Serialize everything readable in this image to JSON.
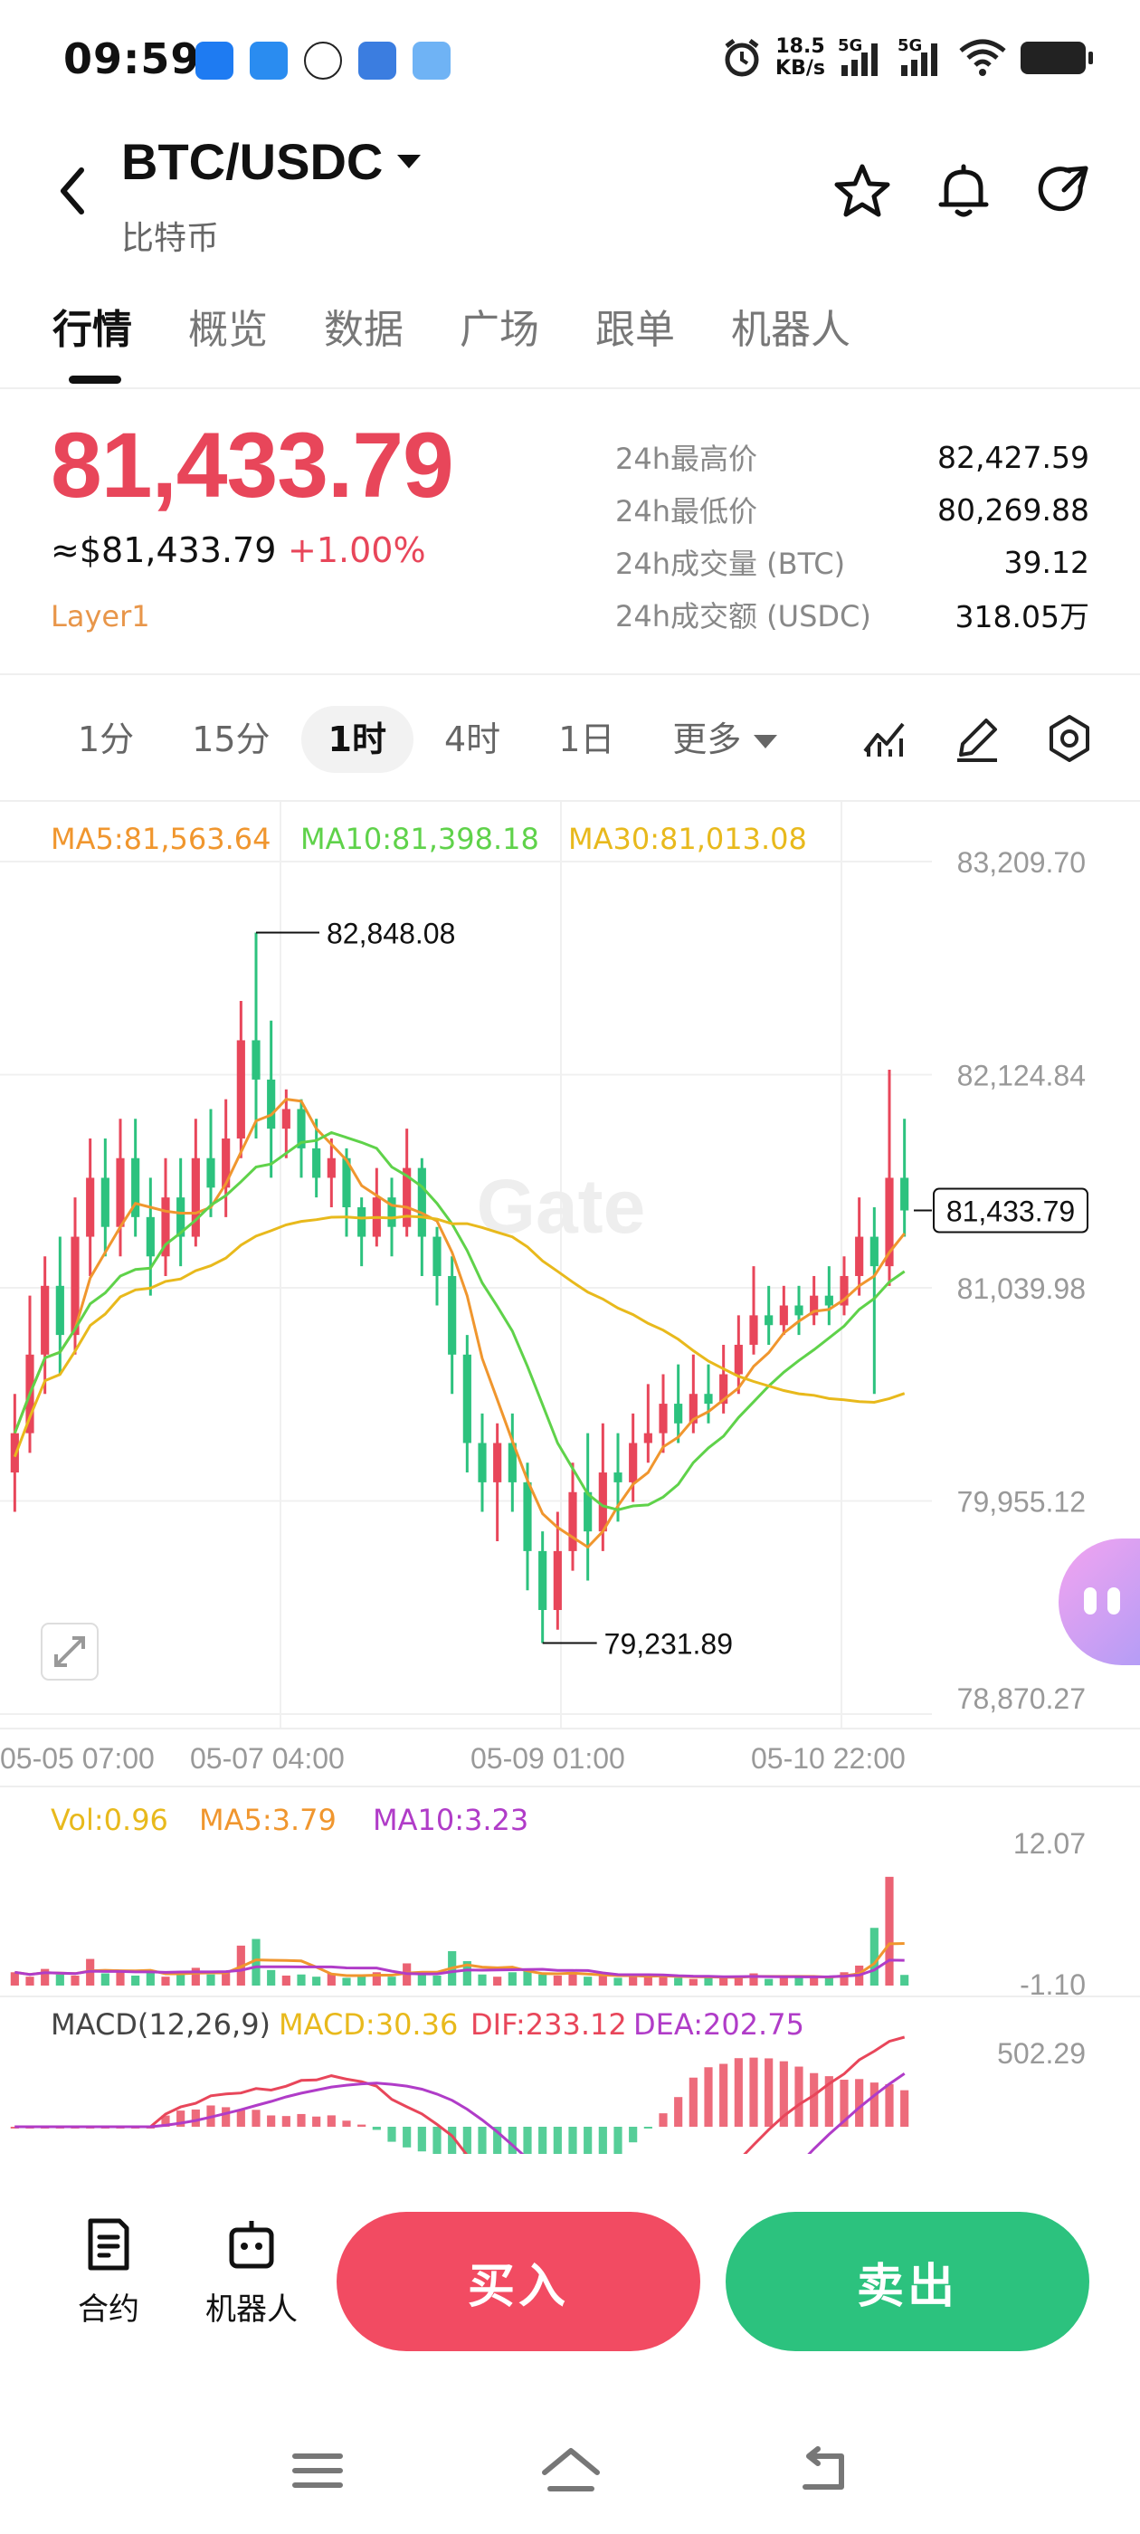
{
  "status_bar": {
    "time": "09:59",
    "net_speed_value": "18.5",
    "net_speed_unit": "KB/s",
    "signal1_label": "5G",
    "signal2_label": "5G"
  },
  "header": {
    "pair": "BTC/USDC",
    "subtitle": "比特币",
    "icons": [
      "back-arrow-icon",
      "star-icon",
      "bell-icon",
      "share-icon"
    ]
  },
  "tabs": [
    "行情",
    "概览",
    "数据",
    "广场",
    "跟单",
    "机器人"
  ],
  "price": {
    "last": "81,433.79",
    "usd": "≈$81,433.79",
    "change": "+1.00%",
    "tag": "Layer1"
  },
  "stats": [
    {
      "label": "24h最高价",
      "value": "82,427.59"
    },
    {
      "label": "24h最低价",
      "value": "80,269.88"
    },
    {
      "label": "24h成交量 (BTC)",
      "value": "39.12"
    },
    {
      "label": "24h成交额 (USDC)",
      "value": "318.05万"
    }
  ],
  "intervals": [
    "1分",
    "15分",
    "1时",
    "4时",
    "1日",
    "更多"
  ],
  "active_interval": "1时",
  "chart_legend": {
    "ma5": "MA5:81,563.64",
    "ma10": "MA10:81,398.18",
    "ma30": "MA30:81,013.08",
    "vol": "Vol:0.96",
    "vol_ma5": "MA5:3.79",
    "vol_ma10": "MA10:3.23",
    "macd_title": "MACD(12,26,9)",
    "macd": "MACD:30.36",
    "dif": "DIF:233.12",
    "dea": "DEA:202.75"
  },
  "colors": {
    "up": "#e8465a",
    "down": "#2cc27e",
    "ma5": "#f0962e",
    "ma10": "#5fd24a",
    "ma30": "#e8b91c",
    "vol_ma10": "#b03cc8",
    "dea": "#b03cc8",
    "watermark": "Gate"
  },
  "chart_data": {
    "type": "candlestick",
    "y_ticks": [
      "83,209.70",
      "82,124.84",
      "81,039.98",
      "79,955.12",
      "78,870.27"
    ],
    "ylim": [
      78870.27,
      83209.7
    ],
    "x_ticks": [
      "05-05 07:00",
      "05-07 04:00",
      "05-09 01:00",
      "05-10 22:00"
    ],
    "current_price_label": "81,433.79",
    "annotations": {
      "high": "82,848.08",
      "low": "79,231.89"
    },
    "volume_ticks": [
      "12.07",
      "-1.10"
    ],
    "macd_ticks": [
      "502.29"
    ],
    "candles": [
      [
        80100,
        80300,
        79900,
        80500
      ],
      [
        80300,
        80700,
        80200,
        81000
      ],
      [
        80700,
        81050,
        80500,
        81200
      ],
      [
        81050,
        80800,
        80600,
        81300
      ],
      [
        80800,
        81300,
        80700,
        81500
      ],
      [
        81300,
        81600,
        81100,
        81800
      ],
      [
        81600,
        81350,
        81200,
        81800
      ],
      [
        81350,
        81700,
        81200,
        81900
      ],
      [
        81700,
        81400,
        81300,
        81900
      ],
      [
        81400,
        81200,
        81000,
        81600
      ],
      [
        81200,
        81500,
        81100,
        81700
      ],
      [
        81500,
        81300,
        81150,
        81700
      ],
      [
        81300,
        81700,
        81250,
        81900
      ],
      [
        81700,
        81550,
        81400,
        81950
      ],
      [
        81550,
        81800,
        81400,
        82000
      ],
      [
        81800,
        82300,
        81700,
        82500
      ],
      [
        82300,
        82100,
        81800,
        82848.08
      ],
      [
        82100,
        81850,
        81600,
        82400
      ],
      [
        81850,
        81950,
        81700,
        82050
      ],
      [
        81950,
        81750,
        81600,
        82000
      ],
      [
        81750,
        81600,
        81500,
        81900
      ],
      [
        81600,
        81700,
        81450,
        81800
      ],
      [
        81700,
        81450,
        81300,
        81750
      ],
      [
        81450,
        81300,
        81150,
        81500
      ],
      [
        81300,
        81500,
        81250,
        81650
      ],
      [
        81500,
        81350,
        81200,
        81600
      ],
      [
        81350,
        81650,
        81300,
        81850
      ],
      [
        81650,
        81300,
        81100,
        81700
      ],
      [
        81300,
        81100,
        80950,
        81350
      ],
      [
        81100,
        80700,
        80500,
        81200
      ],
      [
        80700,
        80250,
        80100,
        80800
      ],
      [
        80250,
        80050,
        79900,
        80400
      ],
      [
        80050,
        80250,
        79750,
        80350
      ],
      [
        80250,
        80050,
        79900,
        80400
      ],
      [
        80050,
        79700,
        79500,
        80150
      ],
      [
        79700,
        79400,
        79231.89,
        79800
      ],
      [
        79400,
        79700,
        79300,
        79900
      ],
      [
        79700,
        80000,
        79600,
        80150
      ],
      [
        80000,
        79800,
        79550,
        80300
      ],
      [
        79800,
        80100,
        79700,
        80350
      ],
      [
        80100,
        80050,
        79850,
        80300
      ],
      [
        80050,
        80250,
        79950,
        80400
      ],
      [
        80250,
        80300,
        80150,
        80550
      ],
      [
        80300,
        80450,
        80200,
        80600
      ],
      [
        80450,
        80350,
        80250,
        80650
      ],
      [
        80350,
        80500,
        80300,
        80700
      ],
      [
        80500,
        80450,
        80350,
        80650
      ],
      [
        80450,
        80600,
        80400,
        80750
      ],
      [
        80600,
        80750,
        80500,
        80900
      ],
      [
        80750,
        80900,
        80700,
        81150
      ],
      [
        80900,
        80850,
        80750,
        81050
      ],
      [
        80850,
        80950,
        80800,
        81050
      ],
      [
        80950,
        80900,
        80800,
        81050
      ],
      [
        80900,
        81000,
        80850,
        81100
      ],
      [
        81000,
        80950,
        80850,
        81150
      ],
      [
        80950,
        81100,
        80900,
        81200
      ],
      [
        81100,
        81300,
        81000,
        81500
      ],
      [
        81300,
        81150,
        80500,
        81450
      ],
      [
        81150,
        81600,
        81050,
        82150
      ],
      [
        81600,
        81433.79,
        81300,
        81900
      ]
    ],
    "volumes": [
      1.2,
      0.8,
      1.5,
      1.0,
      0.9,
      2.4,
      1.1,
      1.3,
      0.9,
      1.2,
      0.8,
      1.1,
      1.6,
      1.0,
      1.2,
      3.6,
      4.2,
      1.4,
      0.9,
      1.0,
      0.8,
      1.1,
      0.7,
      0.9,
      1.2,
      0.8,
      2.0,
      1.1,
      0.9,
      3.1,
      2.2,
      1.0,
      0.8,
      1.2,
      1.4,
      1.0,
      0.9,
      1.1,
      0.8,
      1.0,
      0.7,
      0.9,
      0.8,
      1.0,
      0.7,
      0.6,
      0.8,
      0.7,
      0.9,
      1.1,
      0.6,
      0.8,
      0.7,
      0.9,
      0.8,
      1.2,
      1.8,
      5.2,
      9.8,
      0.96
    ]
  },
  "bottom": {
    "contract_label": "合约",
    "bot_label": "机器人",
    "buy_label": "买入",
    "sell_label": "卖出"
  }
}
